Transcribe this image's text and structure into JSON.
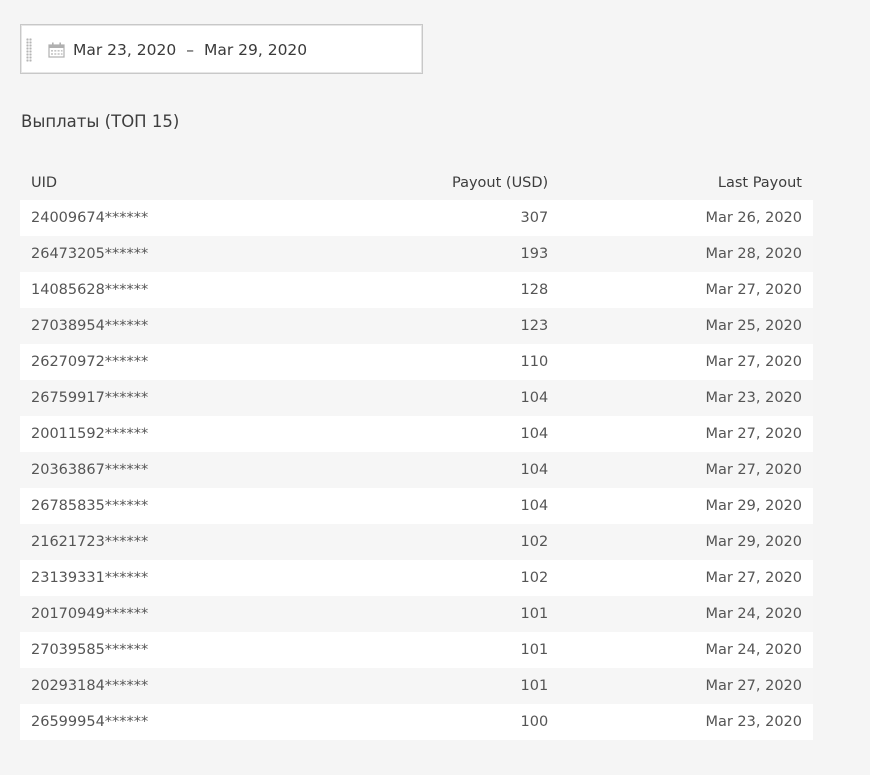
{
  "date_filter": {
    "start_date": "Mar 23, 2020",
    "separator": "–",
    "end_date": "Mar 29, 2020",
    "icon": "calendar-icon"
  },
  "title": "Выплаты (ТОП 15)",
  "table": {
    "columns": [
      "UID",
      "Payout (USD)",
      "Last Payout"
    ],
    "rows": [
      {
        "uid": "24009674******",
        "payout": "307",
        "last_payout": "Mar 26, 2020"
      },
      {
        "uid": "26473205******",
        "payout": "193",
        "last_payout": "Mar 28, 2020"
      },
      {
        "uid": "14085628******",
        "payout": "128",
        "last_payout": "Mar 27, 2020"
      },
      {
        "uid": "27038954******",
        "payout": "123",
        "last_payout": "Mar 25, 2020"
      },
      {
        "uid": "26270972******",
        "payout": "110",
        "last_payout": "Mar 27, 2020"
      },
      {
        "uid": "26759917******",
        "payout": "104",
        "last_payout": "Mar 23, 2020"
      },
      {
        "uid": "20011592******",
        "payout": "104",
        "last_payout": "Mar 27, 2020"
      },
      {
        "uid": "20363867******",
        "payout": "104",
        "last_payout": "Mar 27, 2020"
      },
      {
        "uid": "26785835******",
        "payout": "104",
        "last_payout": "Mar 29, 2020"
      },
      {
        "uid": "21621723******",
        "payout": "102",
        "last_payout": "Mar 29, 2020"
      },
      {
        "uid": "23139331******",
        "payout": "102",
        "last_payout": "Mar 27, 2020"
      },
      {
        "uid": "20170949******",
        "payout": "101",
        "last_payout": "Mar 24, 2020"
      },
      {
        "uid": "27039585******",
        "payout": "101",
        "last_payout": "Mar 24, 2020"
      },
      {
        "uid": "20293184******",
        "payout": "101",
        "last_payout": "Mar 27, 2020"
      },
      {
        "uid": "26599954******",
        "payout": "100",
        "last_payout": "Mar 23, 2020"
      }
    ]
  },
  "colors": {
    "page_background": "#f5f5f5",
    "row_odd": "#ffffff",
    "row_even": "#f6f6f6",
    "text": "#3d3d3d",
    "border": "#c8c8c8"
  }
}
